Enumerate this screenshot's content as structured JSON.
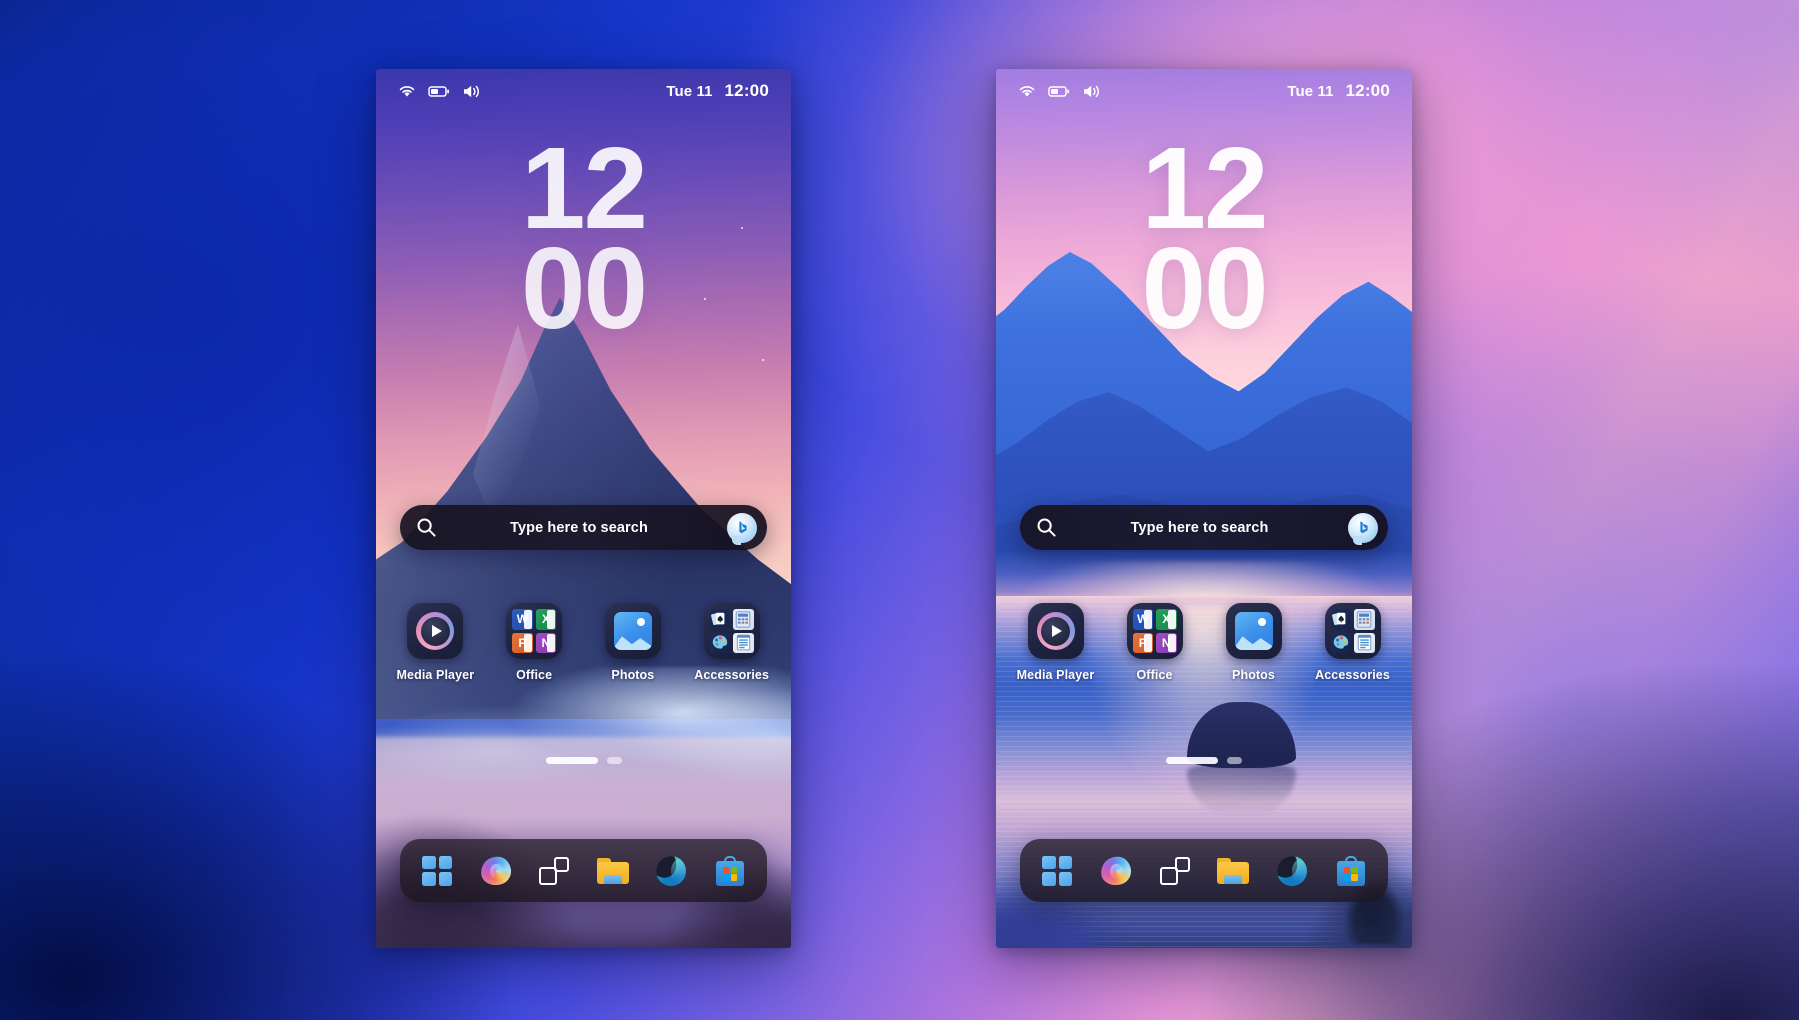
{
  "desktop": {
    "background_colors": {
      "deep_blue": "#0b2ea0",
      "royal_blue": "#2b3fd8",
      "violet": "#7a63e2",
      "pink": "#f4a7c8",
      "magenta": "#e694d4"
    }
  },
  "phones": [
    {
      "id": "left",
      "wallpaper_name": "mountain-peak-dusk",
      "status_bar": {
        "wifi_icon": "wifi-icon",
        "battery_icon": "battery-icon",
        "volume_icon": "volume-icon",
        "date": "Tue 11",
        "time": "12:00"
      },
      "clock_widget": {
        "hours": "12",
        "minutes": "00"
      },
      "search": {
        "search_icon": "search-icon",
        "placeholder": "Type here to search",
        "copilot_icon": "copilot-bing-icon"
      },
      "apps": [
        {
          "label": "Media Player",
          "icon": "media-player-icon",
          "type": "app"
        },
        {
          "label": "Office",
          "icon": "office-folder-icon",
          "type": "folder",
          "contents": [
            "Word",
            "Excel",
            "PowerPoint",
            "OneNote"
          ]
        },
        {
          "label": "Photos",
          "icon": "photos-icon",
          "type": "app"
        },
        {
          "label": "Accessories",
          "icon": "accessories-folder-icon",
          "type": "folder",
          "contents": [
            "Solitaire",
            "Calculator",
            "Paint",
            "Notepad"
          ]
        }
      ],
      "page_indicator": {
        "pages": 2,
        "active_page": 1
      },
      "dock": [
        {
          "label": "Start",
          "icon": "windows-start-icon"
        },
        {
          "label": "Copilot",
          "icon": "copilot-icon"
        },
        {
          "label": "Task View",
          "icon": "task-view-icon"
        },
        {
          "label": "File Explorer",
          "icon": "file-explorer-icon"
        },
        {
          "label": "Microsoft Edge",
          "icon": "edge-icon"
        },
        {
          "label": "Microsoft Store",
          "icon": "microsoft-store-icon"
        }
      ]
    },
    {
      "id": "right",
      "wallpaper_name": "mountain-lake-illustration",
      "status_bar": {
        "wifi_icon": "wifi-icon",
        "battery_icon": "battery-icon",
        "volume_icon": "volume-icon",
        "date": "Tue 11",
        "time": "12:00"
      },
      "clock_widget": {
        "hours": "12",
        "minutes": "00"
      },
      "search": {
        "search_icon": "search-icon",
        "placeholder": "Type here to search",
        "copilot_icon": "copilot-bing-icon"
      },
      "apps": [
        {
          "label": "Media Player",
          "icon": "media-player-icon",
          "type": "app"
        },
        {
          "label": "Office",
          "icon": "office-folder-icon",
          "type": "folder",
          "contents": [
            "Word",
            "Excel",
            "PowerPoint",
            "OneNote"
          ]
        },
        {
          "label": "Photos",
          "icon": "photos-icon",
          "type": "app"
        },
        {
          "label": "Accessories",
          "icon": "accessories-folder-icon",
          "type": "folder",
          "contents": [
            "Solitaire",
            "Calculator",
            "Paint",
            "Notepad"
          ]
        }
      ],
      "page_indicator": {
        "pages": 2,
        "active_page": 1
      },
      "dock": [
        {
          "label": "Start",
          "icon": "windows-start-icon"
        },
        {
          "label": "Copilot",
          "icon": "copilot-icon"
        },
        {
          "label": "Task View",
          "icon": "task-view-icon"
        },
        {
          "label": "File Explorer",
          "icon": "file-explorer-icon"
        },
        {
          "label": "Microsoft Edge",
          "icon": "edge-icon"
        },
        {
          "label": "Microsoft Store",
          "icon": "microsoft-store-icon"
        }
      ]
    }
  ],
  "office_minis": [
    {
      "letter": "W",
      "name": "word-icon"
    },
    {
      "letter": "X",
      "name": "excel-icon"
    },
    {
      "letter": "P",
      "name": "powerpoint-icon"
    },
    {
      "letter": "N",
      "name": "onenote-icon"
    }
  ]
}
